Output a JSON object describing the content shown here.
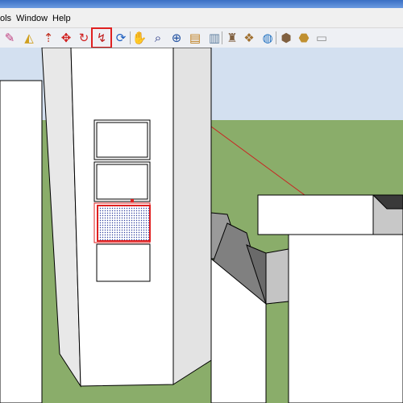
{
  "menu": [
    "ols",
    "Window",
    "Help"
  ],
  "toolbar": {
    "buttons": [
      {
        "icon": "eraser-icon",
        "glyph": "✎",
        "color": "#c04080"
      },
      {
        "icon": "paint-bucket-icon",
        "glyph": "◭",
        "color": "#d0a020"
      },
      {
        "icon": "push-pull-icon",
        "glyph": "⇡",
        "color": "#c03020"
      },
      {
        "icon": "move-icon",
        "glyph": "✥",
        "color": "#d02020"
      },
      {
        "icon": "rotate-icon",
        "glyph": "↻",
        "color": "#d02020"
      },
      {
        "icon": "follow-me-icon",
        "glyph": "↯",
        "color": "#c02020",
        "active": true
      },
      {
        "icon": "orbit-icon",
        "glyph": "⟳",
        "color": "#2060c0"
      },
      {
        "icon": "pan-icon",
        "glyph": "✋",
        "color": "#404040"
      },
      {
        "icon": "zoom-icon",
        "glyph": "⌕",
        "color": "#203080"
      },
      {
        "icon": "zoom-extents-icon",
        "glyph": "⊕",
        "color": "#2050a0"
      },
      {
        "icon": "get-models-icon",
        "glyph": "▤",
        "color": "#c08020"
      },
      {
        "icon": "share-model-icon",
        "glyph": "▥",
        "color": "#6080a0"
      },
      {
        "icon": "place-model-icon",
        "glyph": "♜",
        "color": "#806040"
      },
      {
        "icon": "components-icon",
        "glyph": "❖",
        "color": "#a07030"
      },
      {
        "icon": "google-earth-icon",
        "glyph": "◍",
        "color": "#2070c0"
      },
      {
        "icon": "warehouse-icon",
        "glyph": "⬢",
        "color": "#806040"
      },
      {
        "icon": "extension-icon",
        "glyph": "⬣",
        "color": "#c09030"
      },
      {
        "icon": "print-icon",
        "glyph": "▭",
        "color": "#909090"
      }
    ]
  },
  "colors": {
    "sky": "#d3e0f0",
    "ground": "#8aad6a",
    "selection": "#e02020",
    "edge": "#000000"
  }
}
